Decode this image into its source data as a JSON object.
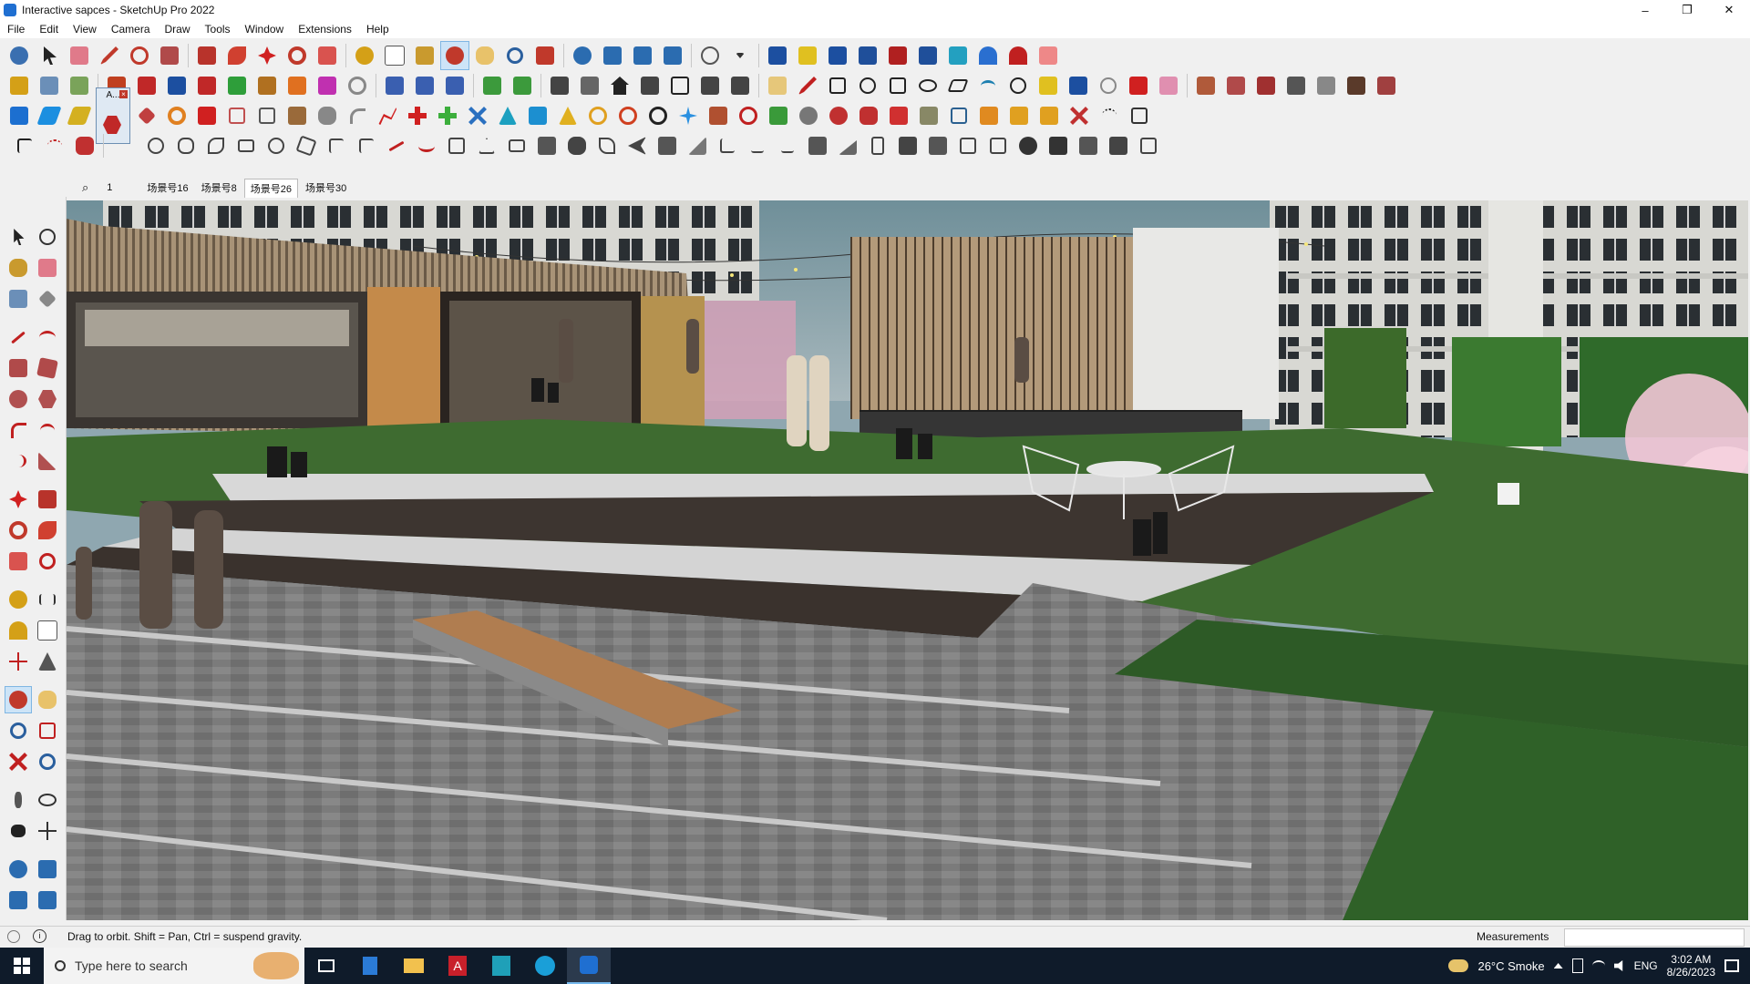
{
  "window": {
    "title": "Interactive sapces - SketchUp Pro 2022",
    "controls": [
      "–",
      "❐",
      "✕"
    ]
  },
  "menu": [
    "File",
    "Edit",
    "View",
    "Camera",
    "Draw",
    "Tools",
    "Window",
    "Extensions",
    "Help"
  ],
  "scenes": {
    "search_glyph": "⌕",
    "tabs": [
      "1",
      "场景号16",
      "场景号8",
      "场景号26",
      "场景号30"
    ],
    "selected_index": 3
  },
  "component_tooltip": "A...",
  "status": {
    "hint": "Drag to orbit. Shift = Pan, Ctrl = suspend gravity.",
    "measurements_label": "Measurements",
    "measurements_value": ""
  },
  "taskbar": {
    "search_placeholder": "Type here to search",
    "weather": "26°C  Smoke",
    "language": "ENG",
    "time": "3:02 AM",
    "date": "8/26/2023"
  },
  "colors": {
    "accent": "#1f6fd1",
    "active_tool_bg": "#cde4f7",
    "taskbar_bg": "#0f1b2a"
  }
}
